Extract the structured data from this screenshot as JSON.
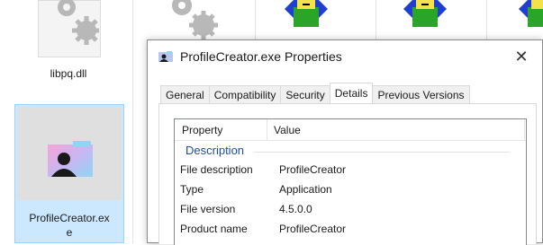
{
  "explorer": {
    "files": [
      {
        "name": "libpq.dll",
        "icon": "gear-icon"
      },
      {
        "name_line1": "ProfileCreator.ex",
        "name_line2": "e",
        "icon": "user-folder-icon",
        "selected": true
      }
    ],
    "icons": [
      "gear-icon",
      "download-box-icon"
    ]
  },
  "dialog": {
    "title": "ProfileCreator.exe Properties",
    "close_symbol": "✕",
    "tabs": [
      "General",
      "Compatibility",
      "Security",
      "Details",
      "Previous Versions"
    ],
    "active_tab": "Details",
    "columns": {
      "property": "Property",
      "value": "Value"
    },
    "group": "Description",
    "rows": [
      {
        "k": "File description",
        "v": "ProfileCreator"
      },
      {
        "k": "Type",
        "v": "Application"
      },
      {
        "k": "File version",
        "v": "4.5.0.0"
      },
      {
        "k": "Product name",
        "v": "ProfileCreator"
      }
    ]
  },
  "colors": {
    "selection": "#cce8ff",
    "group_header": "#1e4d9e",
    "dialog_border": "#8a8a8a"
  }
}
